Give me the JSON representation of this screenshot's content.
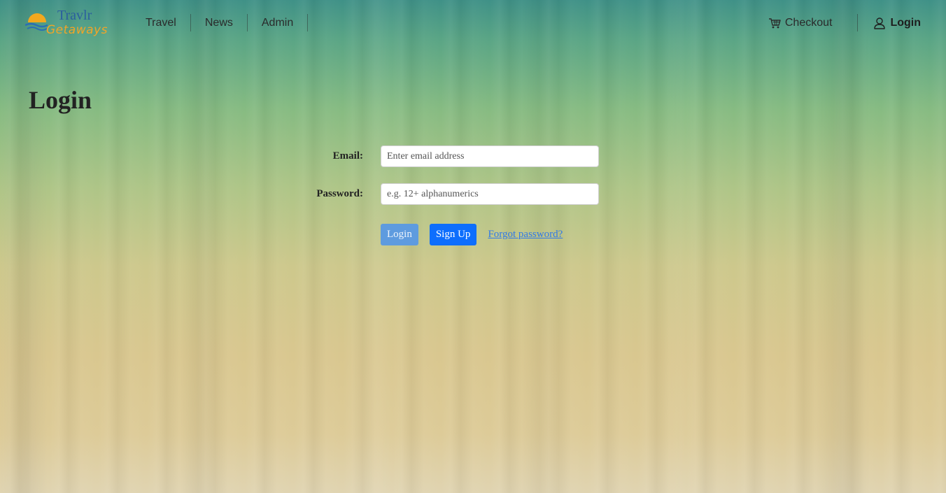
{
  "brand": {
    "line1": "Travlr",
    "line2": "Getaways",
    "colors": {
      "line1": "#2b5e9e",
      "line2": "#f0a528",
      "sun": "#f2a81e",
      "waves": "#2b6fb3"
    }
  },
  "nav": {
    "links": [
      "Travel",
      "News",
      "Admin"
    ],
    "checkout_label": "Checkout",
    "login_label": "Login",
    "icons": {
      "checkout": "shopping-cart-icon",
      "login": "user-icon"
    }
  },
  "page": {
    "title": "Login"
  },
  "form": {
    "email_label": "Email:",
    "email_placeholder": "Enter email address",
    "password_label": "Password:",
    "password_placeholder": "e.g. 12+ alphanumerics",
    "login_button": "Login",
    "signup_button": "Sign Up",
    "forgot_link": "Forgot password?"
  },
  "colors": {
    "primary": "#0d6efd",
    "primary_disabled": "#5e9bdf",
    "link": "#2f79e8"
  }
}
